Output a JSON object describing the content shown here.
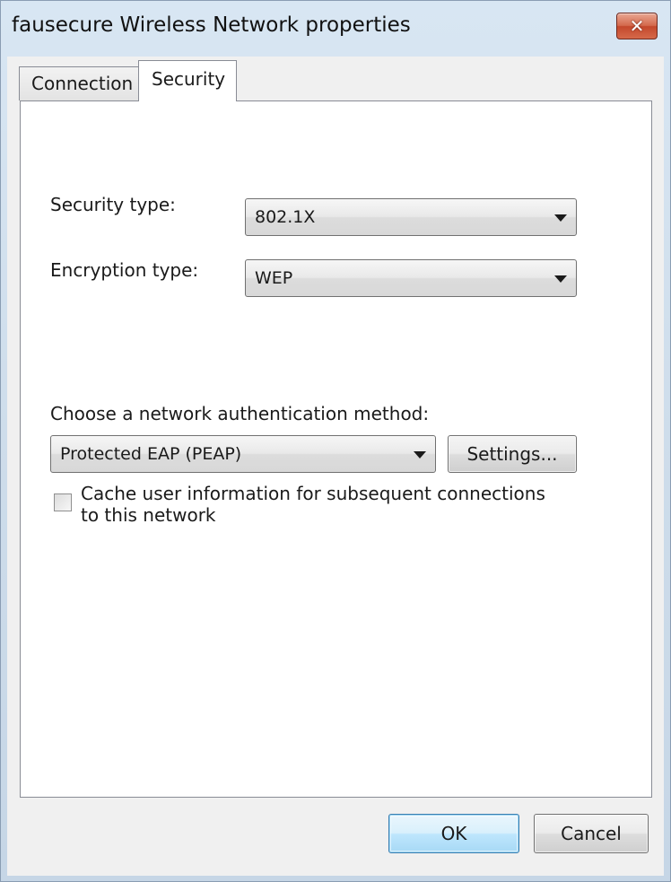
{
  "window": {
    "title": "fausecure Wireless Network properties",
    "close_symbol": "✕"
  },
  "tabs": [
    {
      "label": "Connection",
      "selected": false
    },
    {
      "label": "Security",
      "selected": true
    }
  ],
  "security": {
    "security_type_label": "Security type:",
    "security_type_value": "802.1X",
    "encryption_type_label": "Encryption type:",
    "encryption_type_value": "WEP",
    "auth_method_label": "Choose a network authentication method:",
    "auth_method_value": "Protected EAP (PEAP)",
    "settings_button": "Settings...",
    "cache_checkbox_line1": "Cache user information for subsequent connections",
    "cache_checkbox_line2": "to this network",
    "cache_checked": false
  },
  "footer": {
    "ok_label": "OK",
    "cancel_label": "Cancel"
  },
  "icons": {
    "close": "close-icon",
    "dropdown": "chevron-down-icon"
  }
}
